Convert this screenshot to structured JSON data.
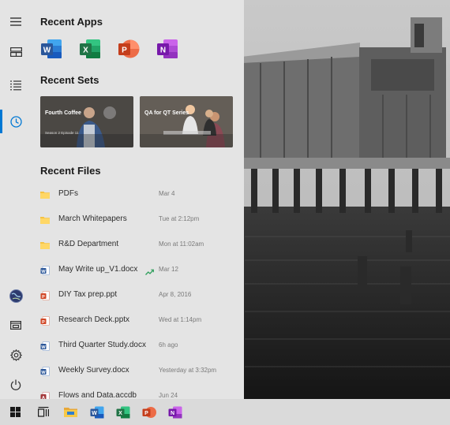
{
  "start_menu": {
    "rail": {
      "hamburger_icon": "hamburger-icon",
      "top_items": [
        {
          "icon": "sets-icon"
        },
        {
          "icon": "list-icon"
        },
        {
          "icon": "clock-icon",
          "active": true
        }
      ],
      "bottom_items": [
        {
          "icon": "globe-avatar-icon"
        },
        {
          "icon": "file-explorer-icon"
        },
        {
          "icon": "gear-icon"
        },
        {
          "icon": "power-icon"
        }
      ]
    },
    "recent_apps": {
      "title": "Recent Apps",
      "apps": [
        {
          "name": "Word",
          "letter": "W",
          "color": "#2b579a"
        },
        {
          "name": "Excel",
          "letter": "X",
          "color": "#217346"
        },
        {
          "name": "PowerPoint",
          "letter": "P",
          "color": "#d24726"
        },
        {
          "name": "OneNote",
          "letter": "N",
          "color": "#80397b"
        }
      ]
    },
    "recent_sets": {
      "title": "Recent Sets",
      "sets": [
        {
          "title": "Fourth Coffee",
          "subtitle": "Season 2 Episode 11"
        },
        {
          "title": "QA for QT Series",
          "subtitle": ""
        }
      ]
    },
    "recent_files": {
      "title": "Recent Files",
      "files": [
        {
          "name": "PDFs",
          "time": "Mar 4",
          "type": "folder"
        },
        {
          "name": "March Whitepapers",
          "time": "Tue at 2:12pm",
          "type": "folder"
        },
        {
          "name": "R&D Department",
          "time": "Mon at 11:02am",
          "type": "folder"
        },
        {
          "name": "May Write up_V1.docx",
          "time": "Mar 12",
          "type": "word",
          "trending": true
        },
        {
          "name": "DIY Tax prep.ppt",
          "time": "Apr 8, 2016",
          "type": "powerpoint"
        },
        {
          "name": "Research Deck.pptx",
          "time": "Wed at 1:14pm",
          "type": "powerpoint"
        },
        {
          "name": "Third Quarter Study.docx",
          "time": "6h ago",
          "type": "word"
        },
        {
          "name": "Weekly Survey.docx",
          "time": "Yesterday at 3:32pm",
          "type": "word"
        },
        {
          "name": "Flows and Data.accdb",
          "time": "Jun 24",
          "type": "access"
        }
      ]
    }
  },
  "taskbar": {
    "items": [
      {
        "icon": "windows-start-icon"
      },
      {
        "icon": "task-view-icon"
      },
      {
        "icon": "file-explorer-icon"
      },
      {
        "icon": "word-icon"
      },
      {
        "icon": "excel-icon"
      },
      {
        "icon": "powerpoint-icon"
      },
      {
        "icon": "onenote-icon"
      }
    ]
  },
  "colors": {
    "accent": "#0078d4",
    "menu_bg": "#e4e4e4",
    "taskbar_bg": "#dadada",
    "folder": "#f5c242",
    "word": "#2b579a",
    "excel": "#217346",
    "powerpoint": "#d24726",
    "onenote": "#80397b",
    "access": "#a4373a"
  }
}
